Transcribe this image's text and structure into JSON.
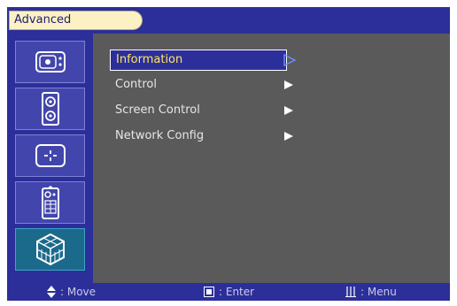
{
  "header": {
    "tab_label": "Advanced"
  },
  "sidebar": {
    "items": [
      {
        "icon": "picture-icon",
        "active": false
      },
      {
        "icon": "speaker-icon",
        "active": false
      },
      {
        "icon": "position-icon",
        "active": false
      },
      {
        "icon": "remote-icon",
        "active": false
      },
      {
        "icon": "advanced-cube-icon",
        "active": true
      }
    ]
  },
  "menu": {
    "items": [
      {
        "label": "Information",
        "selected": true
      },
      {
        "label": "Control",
        "selected": false
      },
      {
        "label": "Screen Control",
        "selected": false
      },
      {
        "label": "Network Config",
        "selected": false
      }
    ]
  },
  "footer": {
    "move_label": ": Move",
    "enter_label": ": Enter",
    "menu_label": ": Menu"
  },
  "colors": {
    "frame_blue": "#2c2f9a",
    "content_gray": "#5a5a5a",
    "selected_text": "#ffe85a",
    "tab_fill": "#fbf1c2"
  }
}
